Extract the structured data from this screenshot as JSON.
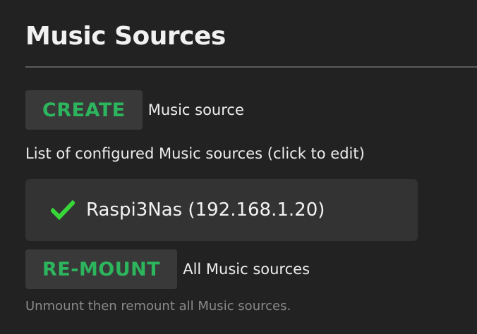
{
  "header": {
    "title": "Music Sources"
  },
  "create": {
    "button_label": "CREATE",
    "description": "Music source"
  },
  "list": {
    "caption": "List of configured Music sources (click to edit)",
    "items": [
      {
        "label": "Raspi3Nas (192.168.1.20)",
        "status_icon": "check-icon",
        "status_color": "#39d63a"
      }
    ]
  },
  "remount": {
    "button_label": "RE-MOUNT",
    "description": "All Music sources",
    "note": "Unmount then remount all Music sources."
  },
  "colors": {
    "accent": "#2db55d",
    "background": "#222222",
    "button_bg": "#393939",
    "item_bg": "#333333"
  }
}
